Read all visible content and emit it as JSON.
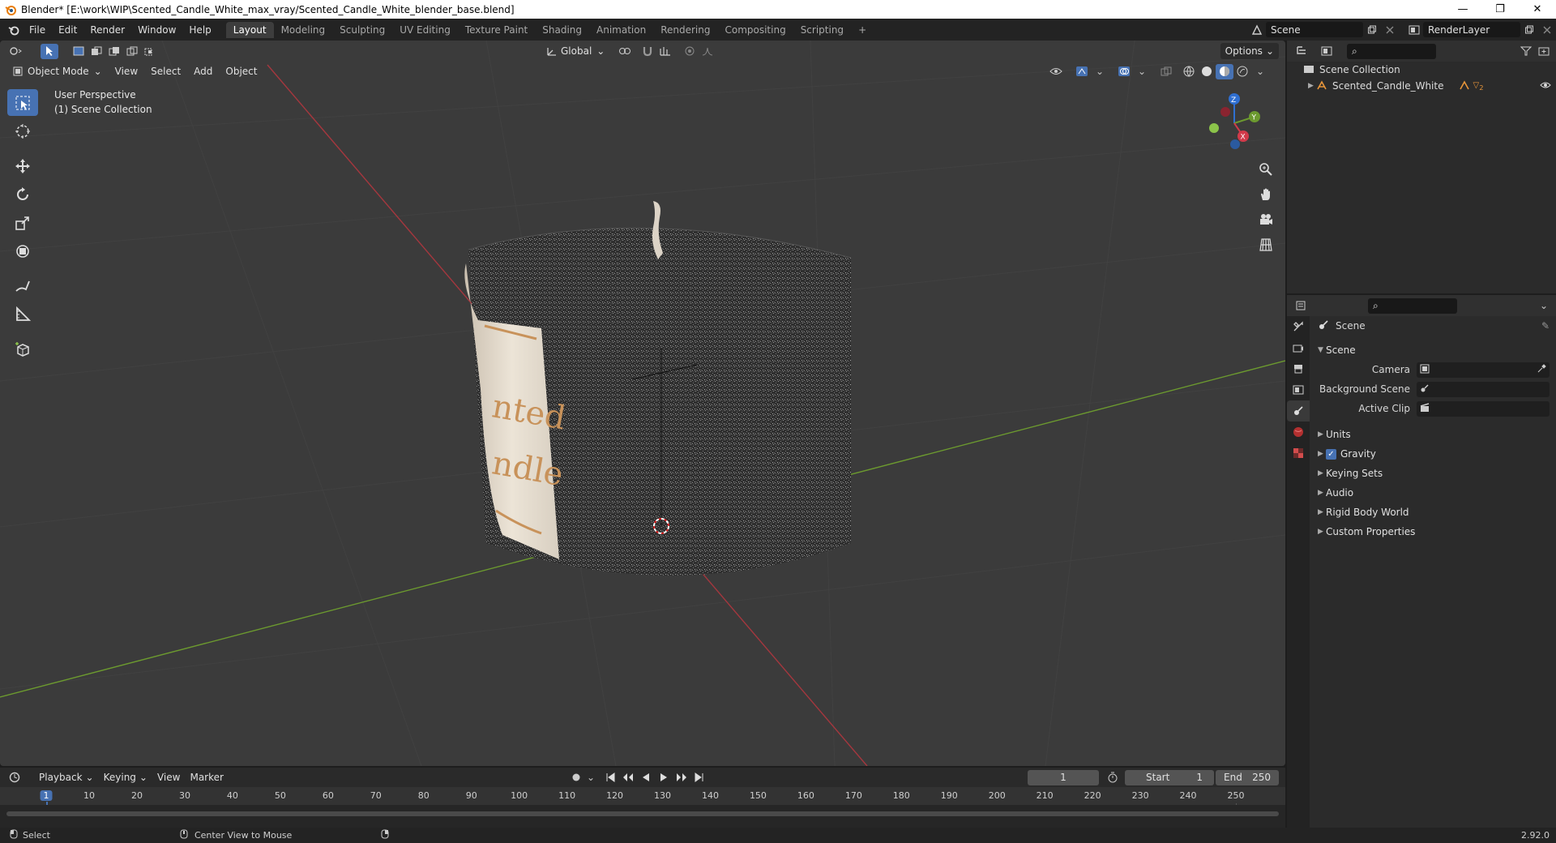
{
  "window": {
    "title": "Blender* [E:\\work\\WIP\\Scented_Candle_White_max_vray/Scented_Candle_White_blender_base.blend]",
    "minimize": "—",
    "restore": "❐",
    "close": "✕"
  },
  "menu": [
    "File",
    "Edit",
    "Render",
    "Window",
    "Help"
  ],
  "workspaces": [
    "Layout",
    "Modeling",
    "Sculpting",
    "UV Editing",
    "Texture Paint",
    "Shading",
    "Animation",
    "Rendering",
    "Compositing",
    "Scripting"
  ],
  "workspace_add": "+",
  "scene_selector": {
    "value": "Scene"
  },
  "view_layer_selector": {
    "value": "RenderLayer"
  },
  "viewport": {
    "transform_orientation": "Global",
    "options_label": "Options",
    "mode": "Object Mode",
    "menus": [
      "View",
      "Select",
      "Add",
      "Object"
    ],
    "overlay_line1": "User Perspective",
    "overlay_line2": "(1) Scene Collection",
    "label_fragment_1": "nted",
    "label_fragment_2": "ndle",
    "gizmo_axes": {
      "x": "X",
      "y": "Y",
      "z": "Z"
    }
  },
  "outliner": {
    "root": "Scene Collection",
    "object": "Scented_Candle_White",
    "object_badge": "2"
  },
  "properties": {
    "context_title": "Scene",
    "panel_scene": "Scene",
    "fields": [
      {
        "label": "Camera",
        "value": ""
      },
      {
        "label": "Background Scene",
        "value": ""
      },
      {
        "label": "Active Clip",
        "value": ""
      }
    ],
    "panels": [
      "Units",
      "Gravity",
      "Keying Sets",
      "Audio",
      "Rigid Body World",
      "Custom Properties"
    ],
    "gravity_checked": true
  },
  "timeline": {
    "menus": [
      "Playback",
      "Keying",
      "View",
      "Marker"
    ],
    "current_frame": "1",
    "start_label": "Start",
    "start": "1",
    "end_label": "End",
    "end": "250",
    "ruler": [
      "1",
      "10",
      "20",
      "30",
      "40",
      "50",
      "60",
      "70",
      "80",
      "90",
      "100",
      "110",
      "120",
      "130",
      "140",
      "150",
      "160",
      "170",
      "180",
      "190",
      "200",
      "210",
      "220",
      "230",
      "240",
      "250"
    ]
  },
  "status": {
    "left": "Select",
    "middle": "Center View to Mouse",
    "version": "2.92.0"
  },
  "colors": {
    "accent": "#4772b3",
    "x_axis": "#a5373e",
    "y_axis": "#6c9a2f",
    "z_axis": "#2f6fd1"
  }
}
